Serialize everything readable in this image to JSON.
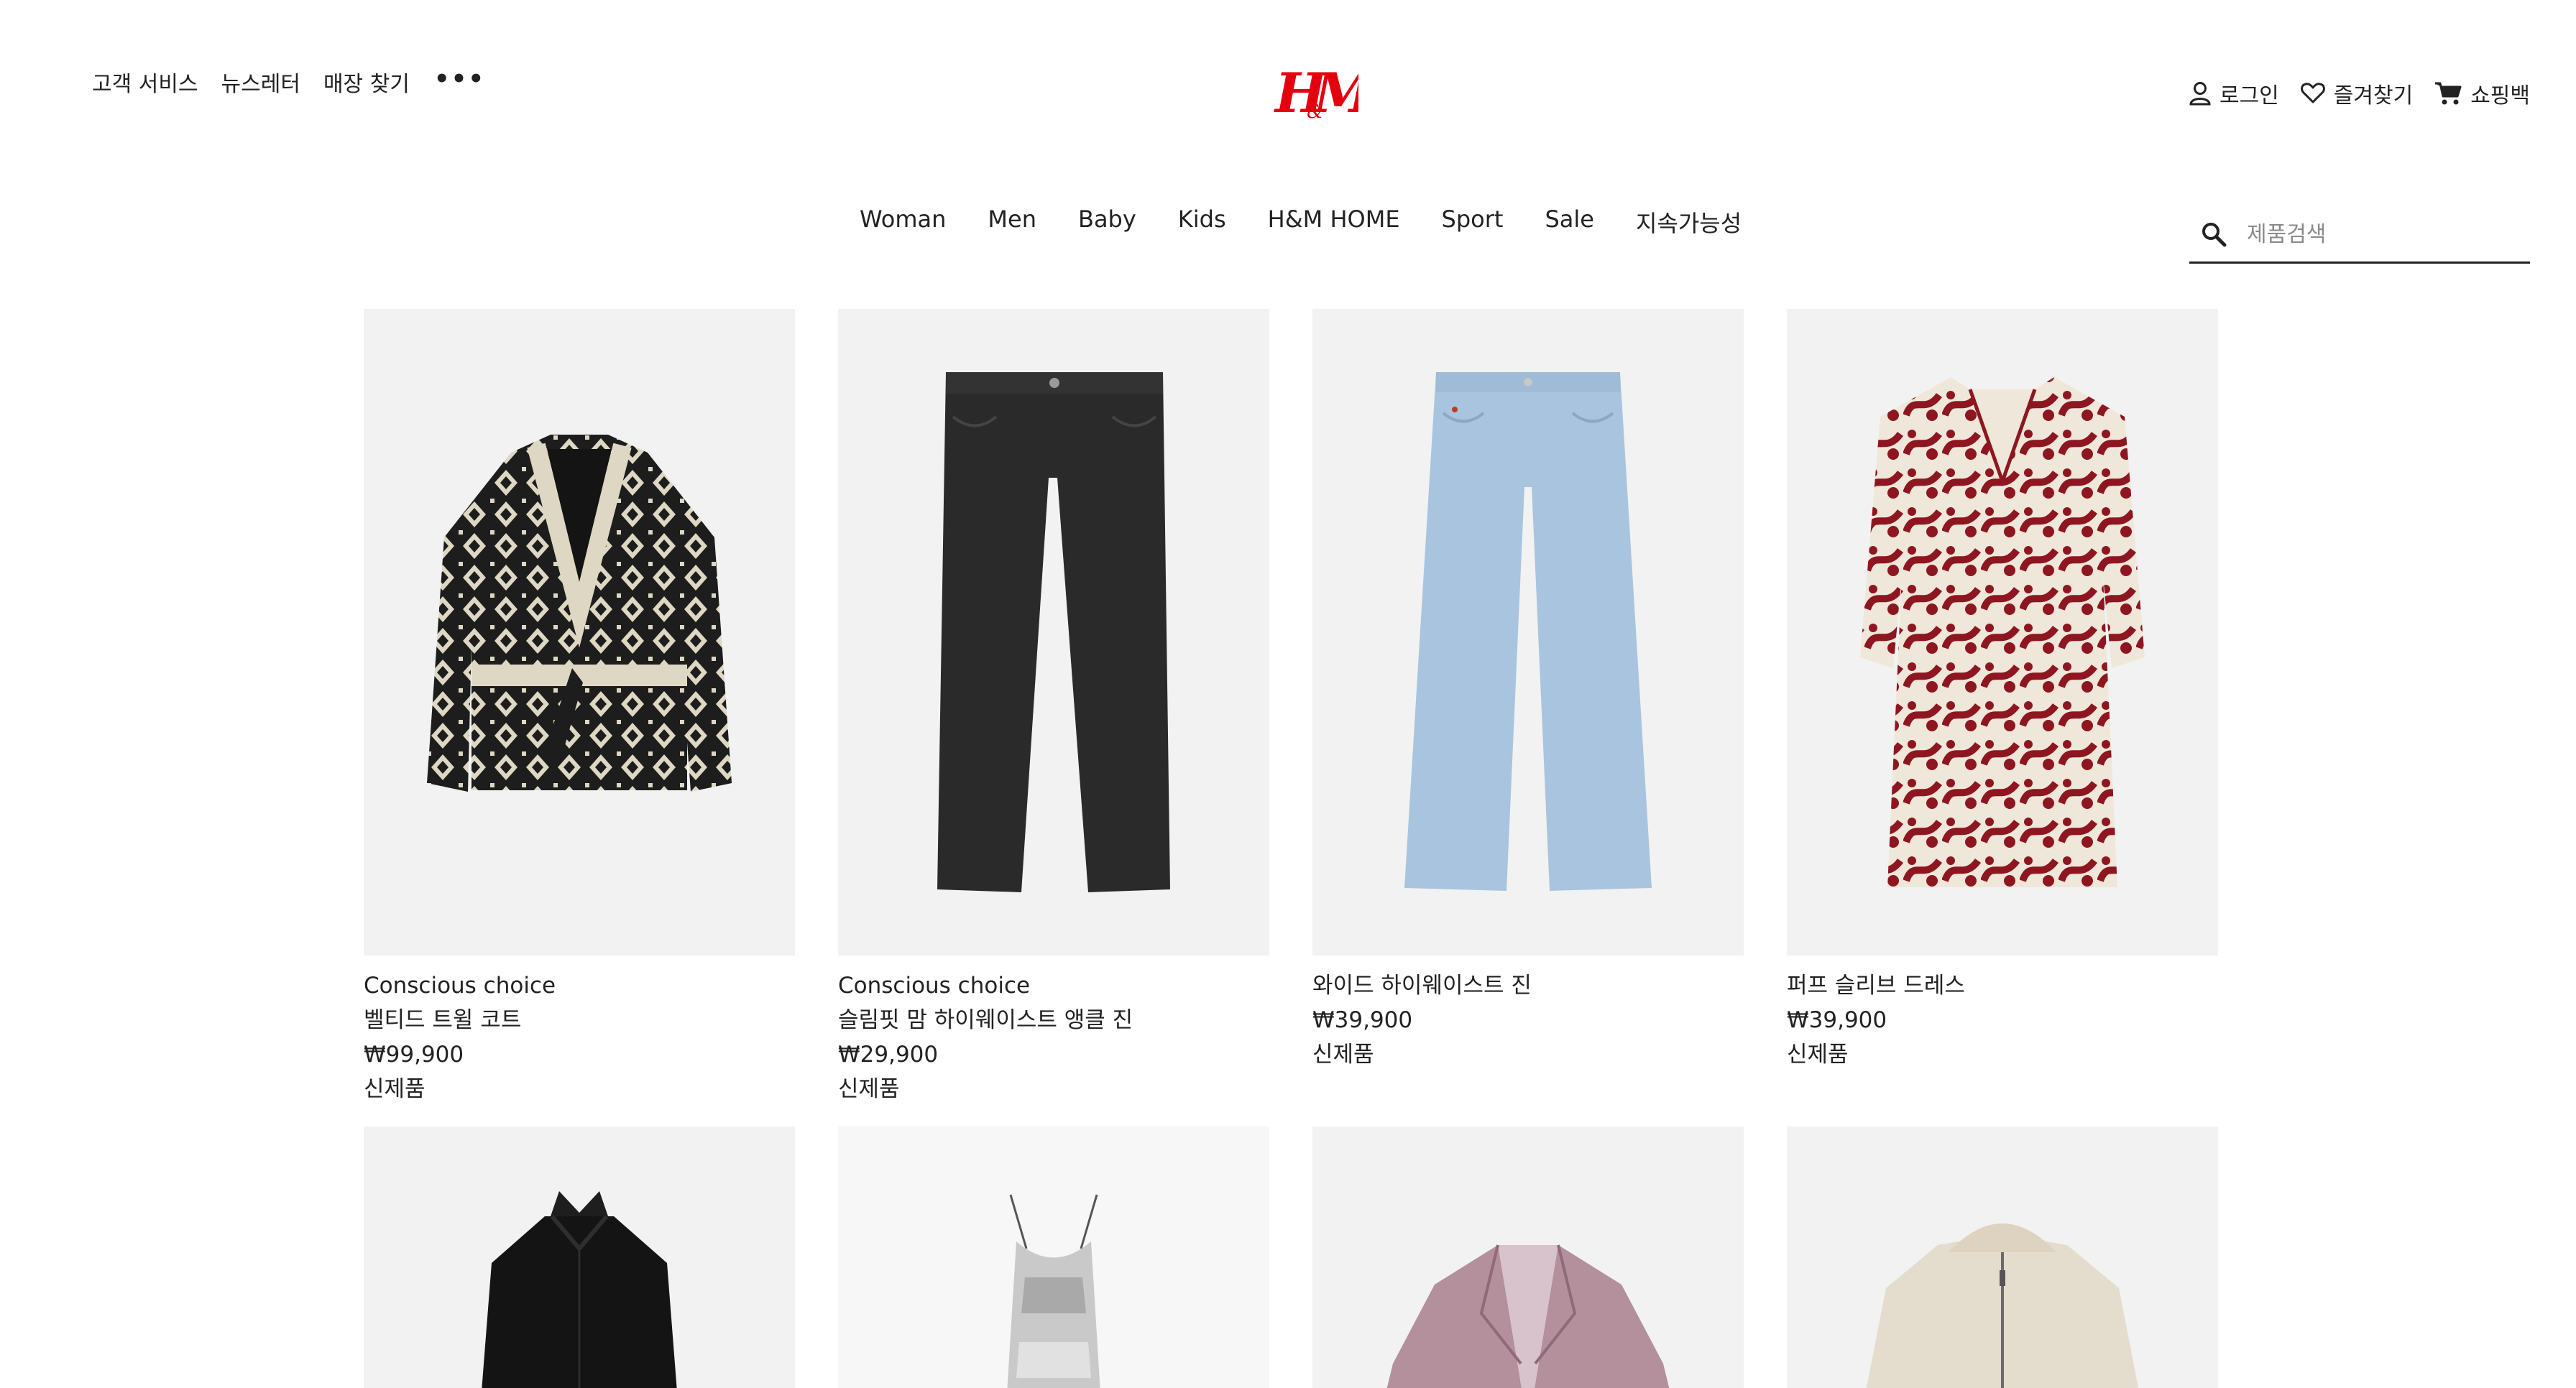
{
  "header": {
    "utility_links": [
      "고객 서비스",
      "뉴스레터",
      "매장 찾기"
    ],
    "more_icon": "more-dots-icon",
    "logo_text": "H&M",
    "brand_color": "#e50010",
    "account": {
      "login_label": "로그인",
      "favorites_label": "즐겨찾기",
      "bag_label": "쇼핑백"
    }
  },
  "nav": {
    "items": [
      "Woman",
      "Men",
      "Baby",
      "Kids",
      "H&M HOME",
      "Sport",
      "Sale",
      "지속가능성"
    ]
  },
  "search": {
    "placeholder": "제품검색",
    "icon": "search-icon"
  },
  "products": [
    {
      "tag": "Conscious choice",
      "name": "벨티드 트윌 코트",
      "price": "₩99,900",
      "badge": "신제품",
      "image": "black-cream-patterned-belted-coat"
    },
    {
      "tag": "Conscious choice",
      "name": "슬림핏 맘 하이웨이스트 앵클 진",
      "price": "₩29,900",
      "badge": "신제품",
      "image": "black-jeans"
    },
    {
      "tag": "",
      "name": "와이드 하이웨이스트 진",
      "price": "₩39,900",
      "badge": "신제품",
      "image": "light-blue-wide-jeans"
    },
    {
      "tag": "",
      "name": "퍼프 슬리브 드레스",
      "price": "₩39,900",
      "badge": "신제품",
      "image": "red-floral-dress"
    },
    {
      "image": "black-ruffle-dress"
    },
    {
      "image": "silver-sequin-slip-dress"
    },
    {
      "image": "pink-wool-blazer"
    },
    {
      "image": "beige-teddy-hooded-jacket"
    }
  ]
}
